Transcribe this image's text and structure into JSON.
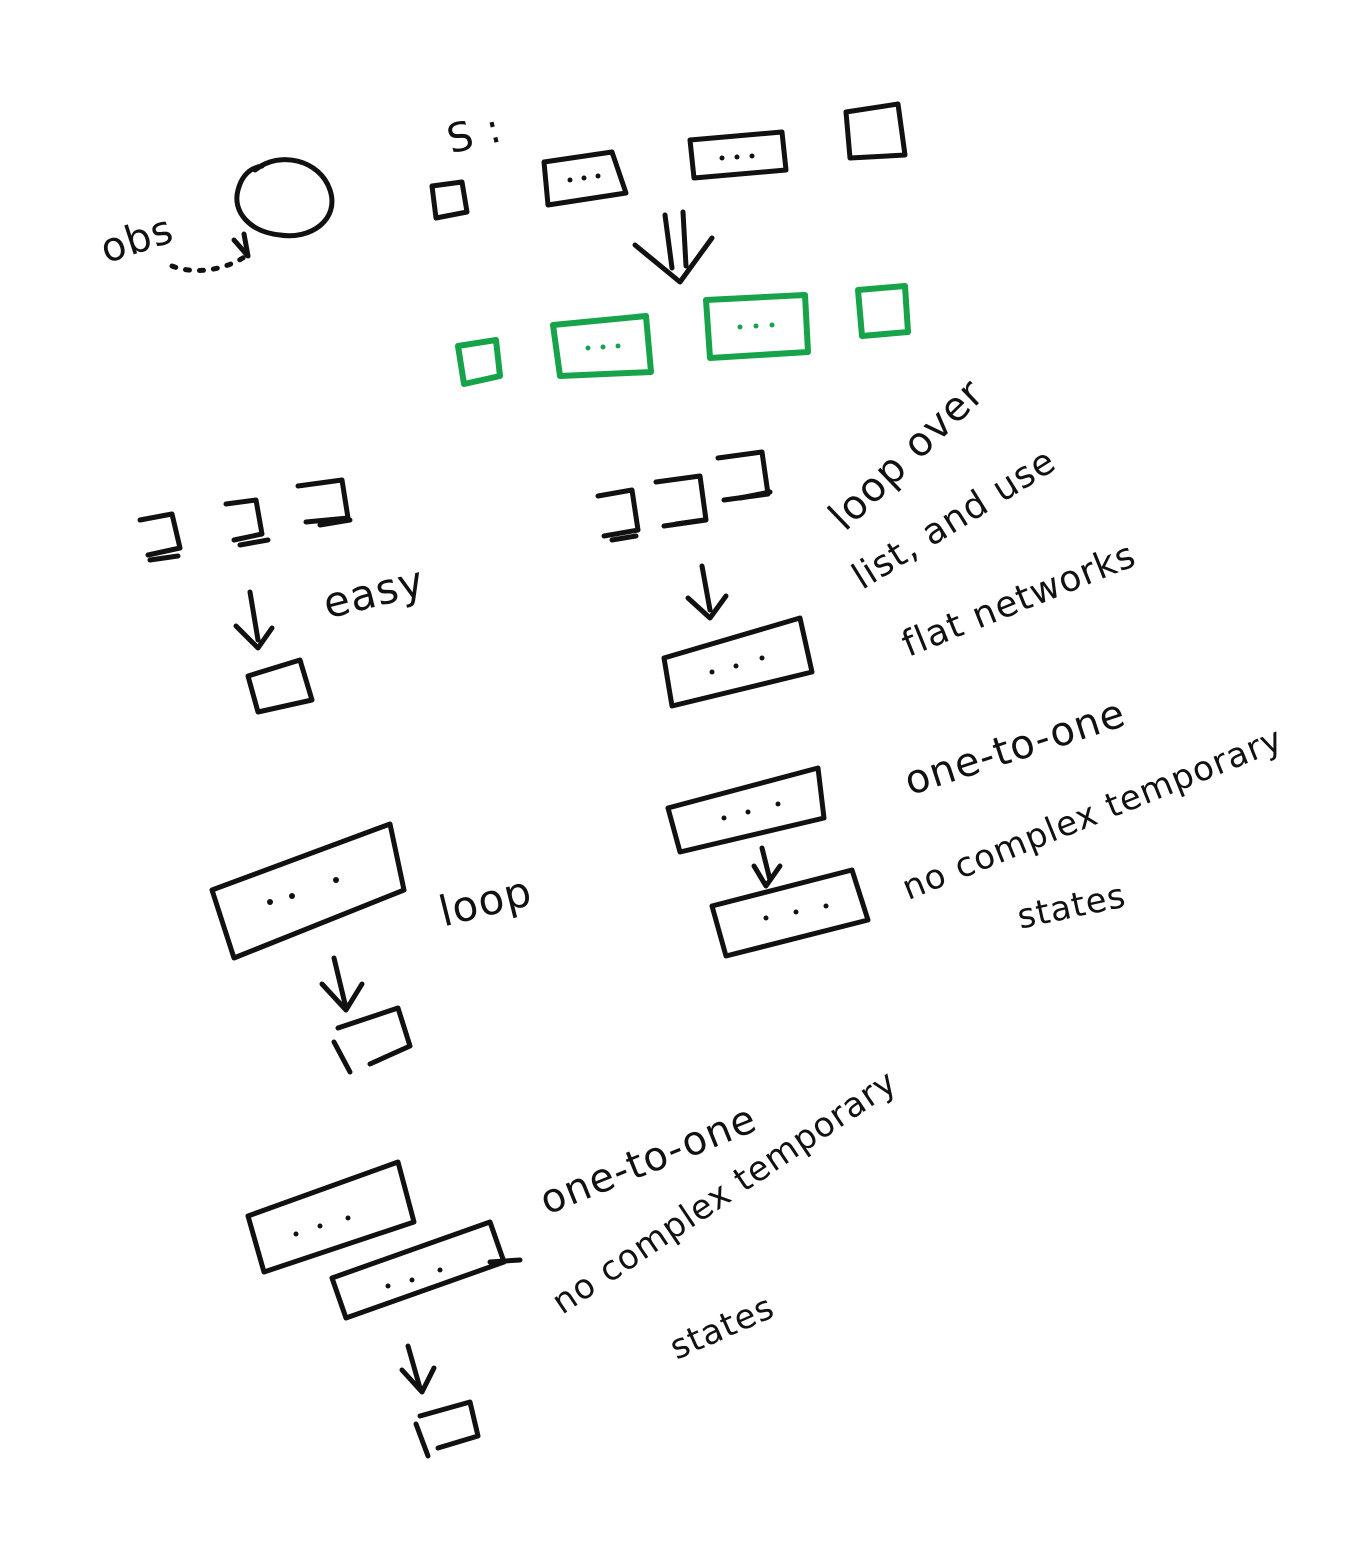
{
  "labels": {
    "obs": "obs",
    "s": "S :",
    "easy": "easy",
    "loop_over_1": "loop over",
    "loop_over_2": "list, and use",
    "loop_over_3": "flat networks",
    "loop": "loop",
    "one_to_one_a": "one-to-one",
    "no_complex_a": "no complex temporary",
    "states_a": "states",
    "one_to_one_b": "one-to-one",
    "no_complex_b": "no complex temporary",
    "states_b": "states"
  },
  "colors": {
    "ink": "#111111",
    "highlight": "#16a34a",
    "background": "#ffffff"
  }
}
